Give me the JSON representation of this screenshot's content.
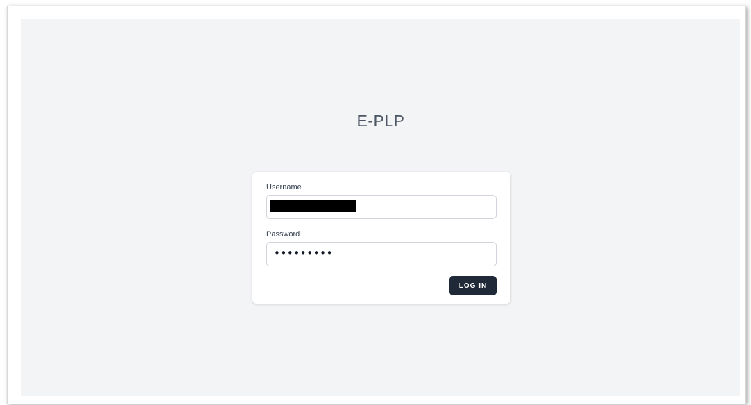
{
  "app": {
    "title": "E-PLP"
  },
  "login_form": {
    "username_label": "Username",
    "username_value": "",
    "username_redacted": true,
    "password_label": "Password",
    "password_mask": "•••••••••",
    "submit_label": "LOG IN"
  },
  "colors": {
    "page_background": "#f3f4f6",
    "card_background": "#ffffff",
    "button_background": "#1f2937",
    "button_text": "#ffffff",
    "title_text": "#4b5563"
  }
}
